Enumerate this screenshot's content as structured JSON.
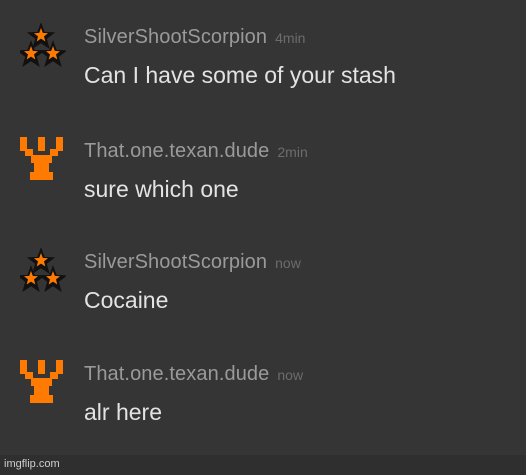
{
  "messages": [
    {
      "username": "SilverShootScorpion",
      "time": "4min",
      "text": "Can I have some of your stash",
      "avatar_icon": "three-stars-icon"
    },
    {
      "username": "That.one.texan.dude",
      "time": "2min",
      "text": "sure which one",
      "avatar_icon": "orange-trident-icon"
    },
    {
      "username": "SilverShootScorpion",
      "time": "now",
      "text": "Cocaine",
      "avatar_icon": "three-stars-icon"
    },
    {
      "username": "That.one.texan.dude",
      "time": "now",
      "text": "alr here",
      "avatar_icon": "orange-trident-icon"
    }
  ],
  "watermark": "imgflip.com",
  "colors": {
    "background": "#353535",
    "username": "#9a9a9a",
    "timestamp": "#6c6c6c",
    "message_text": "#e3e3e3",
    "avatar_orange": "#ff7a00"
  }
}
